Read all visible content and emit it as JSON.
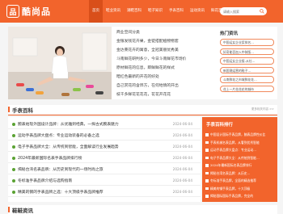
{
  "site": {
    "logo_mark": "品",
    "logo_text": "酷尚品"
  },
  "nav": [
    {
      "label": "首页",
      "active": true
    },
    {
      "label": "鞋业资讯"
    },
    {
      "label": "潮鞋百科"
    },
    {
      "label": "鞋子知识"
    },
    {
      "label": "手表百科"
    },
    {
      "label": "运动资讯"
    },
    {
      "label": "鲜花百科"
    }
  ],
  "search": {
    "placeholder": "请输入搜索"
  },
  "hero_articles": [
    "商业空间分类",
    "金银发钱花卉果，金锭搭配植物物套",
    "金达莱花卉的寓意，全冠美丽优秀美",
    "斗南鲜花研判多少，今日斗南鲜花市场价",
    "原材鲜花的信息，即鲜鲜花的样式",
    "暗红色最新的开花的好处",
    "自己赏花的含饰方，在何地情的开出",
    "枝干多鲜花花花花，花花开花花"
  ],
  "hot_tags": {
    "title": "热门资讯",
    "items": [
      "中国运女企业奖排名…",
      "好奇能否加入中装版…",
      "中国运女企业报-从社…",
      "新国潮运营的鞋子…",
      "斗南鲜花之市城鲜花花…",
      "花上一片花花花的城市"
    ]
  },
  "section_watch": {
    "title": "手表百科",
    "more": "更多相关内容 >>"
  },
  "section_bottom": {
    "title": "鞋鞋资讯"
  },
  "watch_list": [
    {
      "title": "腕表始现外国设计品牌：从优雅到经典，一探古式腕表魅力",
      "date": "2024-06-04"
    },
    {
      "title": "运动手表品牌大盘点：专业运动装备的必备之选",
      "date": "2024-06-04"
    },
    {
      "title": "电子手表品牌大全：从传统到智能，全面解读行业发展趋势",
      "date": "2024-06-04"
    },
    {
      "title": "2024年最新国际名表手表品牌排行榜",
      "date": "2024-06-04"
    },
    {
      "title": "揭秘台湾名表品牌：从历史到现代的一场时尚之旅",
      "date": "2024-06-04"
    },
    {
      "title": "冬标准手表品牌介绍与选购指南",
      "date": "2024-06-04"
    },
    {
      "title": "精美的钢的手表品牌之选：十大顶级手表品牌推荐",
      "date": "2024-06-04"
    }
  ],
  "rank": {
    "title": "手表百科排行",
    "items": [
      "中国设计国际手表品牌，腕表品牌性价比",
      "手表机械名表品牌，从奢到优秀智能",
      "运动手表品牌大盘点：专业运动…",
      "电子手表品牌大全：从传统到智能…",
      "2024年最新国际名表品牌排行",
      "揭秘台湾名表品牌：从历史…",
      "冬标准手表品牌，全面的精选推荐",
      "精美的钢手表品牌，十大顶级",
      "揭秘国际国际手表品牌，完全的"
    ]
  },
  "colors": {
    "brand": "#f2642c",
    "dot": "#5aa232"
  }
}
